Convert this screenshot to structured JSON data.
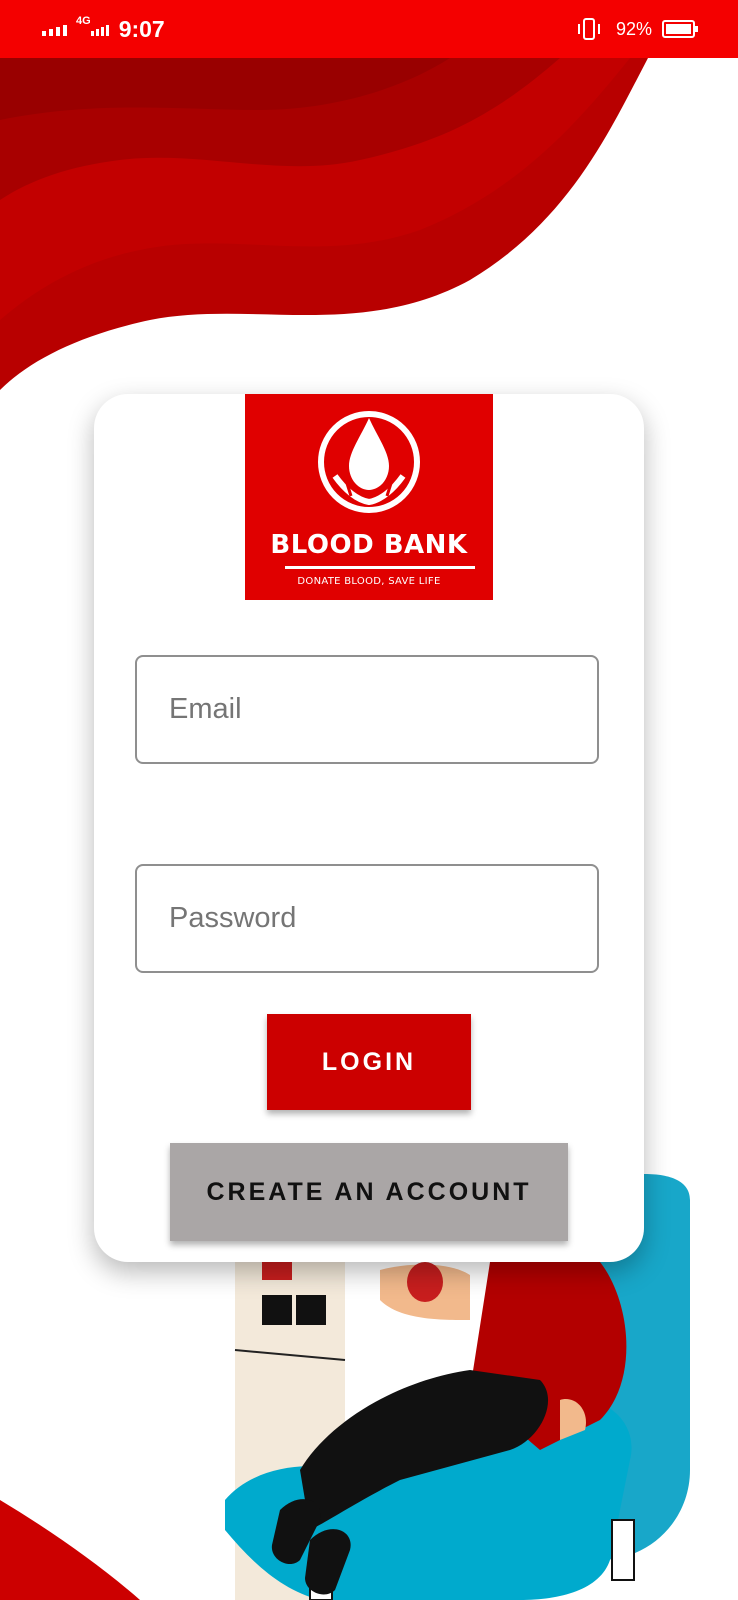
{
  "status_bar": {
    "time": "9:07",
    "network": "4G",
    "battery": "92%"
  },
  "logo": {
    "title": "BLOOD BANK",
    "tagline": "DONATE BLOOD, SAVE LIFE"
  },
  "login_form": {
    "email_placeholder": "Email",
    "password_placeholder": "Password",
    "login_label": "LOGIN",
    "create_account_label": "CREATE AN ACCOUNT"
  },
  "colors": {
    "brand_red": "#f40000",
    "button_red": "#cc0000",
    "secondary_gray": "#aaa6a6"
  }
}
